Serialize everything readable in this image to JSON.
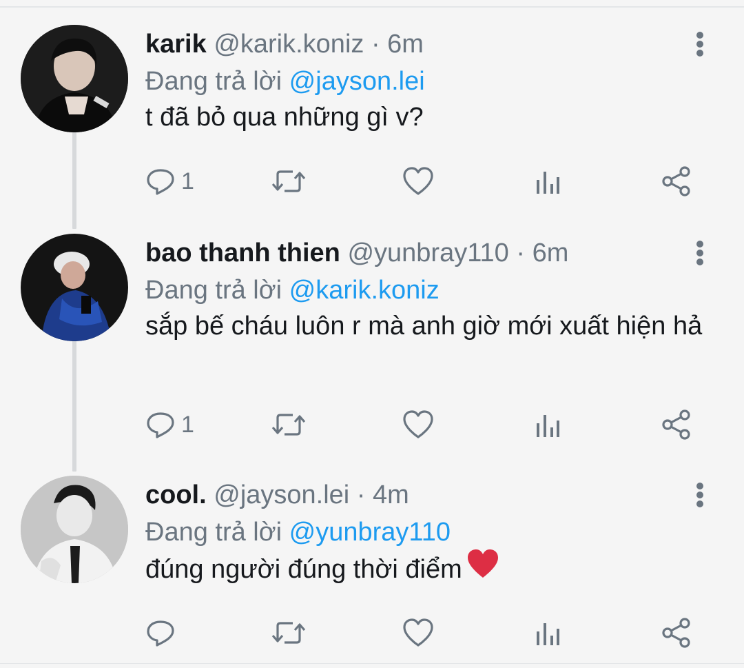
{
  "tweets": [
    {
      "display_name": "karik",
      "handle": "@karik.koniz",
      "time": " · 6m",
      "reply_prefix": "Đang trả lời ",
      "reply_to": "@jayson.lei",
      "text": "t đã bỏ qua những gì v?",
      "reply_count": "1",
      "has_heart_emoji": false
    },
    {
      "display_name": "bao thanh thien",
      "handle": "@yunbray110",
      "time": " · 6m",
      "reply_prefix": "Đang trả lời ",
      "reply_to": "@karik.koniz",
      "text": "sắp bế cháu luôn r mà anh giờ mới xuất hiện hả",
      "reply_count": "1",
      "has_heart_emoji": false
    },
    {
      "display_name": "cool.",
      "handle": "@jayson.lei",
      "time": " · 4m",
      "reply_prefix": "Đang trả lời ",
      "reply_to": "@yunbray110",
      "text": "đúng người đúng thời điểm",
      "reply_count": "",
      "has_heart_emoji": true
    }
  ],
  "icons": {
    "reply": "reply-icon",
    "retweet": "retweet-icon",
    "like": "like-icon",
    "analytics": "analytics-icon",
    "share": "share-icon",
    "more": "more-vertical-icon",
    "emoji": "red-heart-emoji"
  },
  "colors": {
    "background": "#f5f5f5",
    "text": "#16191d",
    "secondary": "#6a7580",
    "accent": "#1d9bf0",
    "thread_line": "#d7d9db"
  }
}
